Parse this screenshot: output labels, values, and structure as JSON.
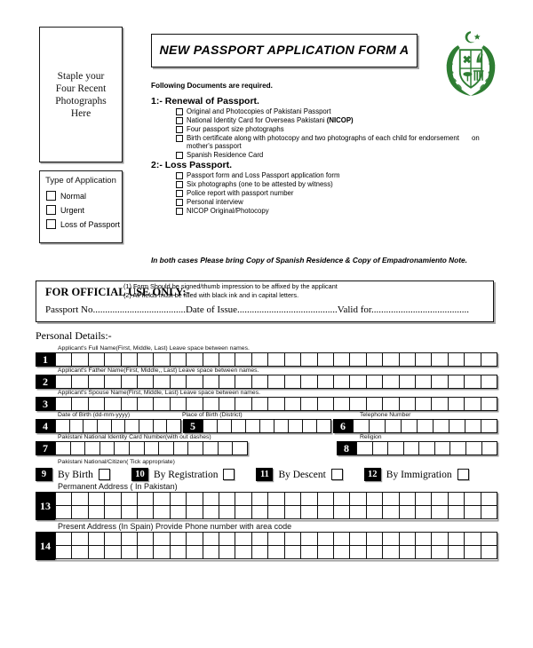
{
  "header": {
    "photo_box_text": "Staple your\nFour Recent\nPhotographs\nHere",
    "photo_box_lines": [
      "Staple your",
      "Four Recent",
      "Photographs",
      "Here"
    ],
    "title": "NEW PASSPORT APPLICATION FORM A",
    "emblem_name": "pakistan-state-emblem",
    "emblem_color": "#2e7d32"
  },
  "type_of_application": {
    "title": "Type of Application",
    "options": [
      {
        "label": "Normal",
        "checked": false
      },
      {
        "label": "Urgent",
        "checked": false
      },
      {
        "label": "Loss of Passport",
        "checked": false
      }
    ]
  },
  "documents": {
    "intro": "Following Documents are required.",
    "sections": [
      {
        "heading": "1:- Renewal of Passport.",
        "items": [
          {
            "text": "Original and Photocopies of Pakistani Passport",
            "bold_suffix": "",
            "continuation": ""
          },
          {
            "text": "National Identity Card for Overseas Pakistani ",
            "bold_suffix": "(NICOP)",
            "continuation": ""
          },
          {
            "text": "Four passport size photographs",
            "bold_suffix": "",
            "continuation": ""
          },
          {
            "text": "Birth certificate along with photocopy and two photographs of each child for endorsement",
            "bold_suffix": "",
            "continuation": "on mother's passport"
          },
          {
            "text": "Spanish Residence Card",
            "bold_suffix": "",
            "continuation": ""
          }
        ]
      },
      {
        "heading": "2:- Loss Passport.",
        "items": [
          {
            "text": "Passport form and Loss Passport application form",
            "bold_suffix": "",
            "continuation": ""
          },
          {
            "text": "Six photographs (one to be attested by witness)",
            "bold_suffix": "",
            "continuation": ""
          },
          {
            "text": "Police report with passport number",
            "bold_suffix": "",
            "continuation": ""
          },
          {
            "text": "Personal interview",
            "bold_suffix": "",
            "continuation": ""
          },
          {
            "text": "NICOP Original/Photocopy",
            "bold_suffix": "",
            "continuation": ""
          }
        ]
      }
    ],
    "both_cases_note": "In both cases Please bring Copy of Spanish Residence & Copy of Empadronamiento Note.",
    "notes": [
      "(1) Form Should be signed/thumb impression to be affixed by the applicant",
      "(2) All fields must be filled with black ink and in capital letters."
    ]
  },
  "official_use": {
    "heading": "FOR OFFICIAL USE ONLY:-",
    "line": "Passport No......................................Date of Issue.........................................Valid for........................................"
  },
  "personal_details": {
    "title": "Personal Details:-",
    "rows": [
      {
        "num": "1",
        "label": "Applicant's Full Name(First, Middle, Last) Leave space between names.",
        "cells": 27,
        "lines": 1
      },
      {
        "num": "2",
        "label": "Applicant's Father Name(First, Middle,, Last) Leave space between names.",
        "cells": 27,
        "lines": 1
      },
      {
        "num": "3",
        "label": "Applicant's Spouse Name(First, Middle, Last) Leave space between names.",
        "cells": 27,
        "lines": 1
      }
    ],
    "row4_label": "Date of Birth (dd-mm-yyyy)",
    "row4_num": "4",
    "row4_cells": 9,
    "row5_label": "Place of Birth (District)",
    "row5_num": "5",
    "row5_cells": 9,
    "row6_label": "Telephone Number",
    "row6_num": "6",
    "row6_cells": 9,
    "row7_label": "Pakistani National Identity Card Number(with out dashes)",
    "row7_num": "7",
    "row7_cells": 13,
    "row8_label": "Religion",
    "row8_num": "8",
    "row8_cells": 9,
    "citizen_label": "Pakistani National/Citizen( Tick appropriate)",
    "citizen_options": [
      {
        "num": "9",
        "label": "By Birth",
        "checked": false
      },
      {
        "num": "10",
        "label": "By Registration",
        "checked": false
      },
      {
        "num": "11",
        "label": "By Descent",
        "checked": false
      },
      {
        "num": "12",
        "label": "By Immigration",
        "checked": false
      }
    ],
    "row13_label": "Permanent Address  ( In Pakistan)",
    "row13_num": "13",
    "row13_cells": 27,
    "row13_lines": 2,
    "row14_label": "Present Address (In Spain) Provide Phone number with area code",
    "row14_num": "14",
    "row14_cells": 27,
    "row14_lines": 2
  }
}
